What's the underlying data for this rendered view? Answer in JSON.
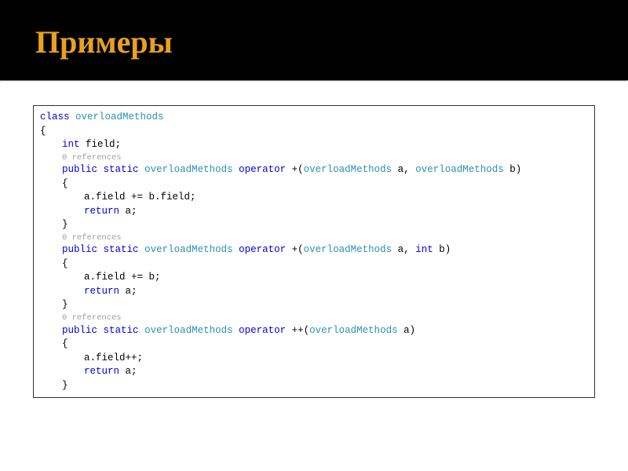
{
  "slide": {
    "title": "Примеры"
  },
  "code": {
    "ref_text": "0 references",
    "kw": {
      "class": "class",
      "int": "int",
      "public": "public",
      "static": "static",
      "operator": "operator",
      "return": "return"
    },
    "typ": {
      "overloadMethods": "overloadMethods"
    },
    "lines": {
      "l1_class": "class ",
      "l2_brace": "{",
      "l3_pre": "    ",
      "l3_int": "int",
      "l3_rest": " field;",
      "m1_sig_pre": "public static ",
      "m1_sig_mid1": " operator +(",
      "m1_sig_mid2": " a, ",
      "m1_sig_end": " b)",
      "m_brace_open": "{",
      "m1_body1": "a.field += b.field;",
      "m_return": "return",
      "m_return_rest": " a;",
      "m_brace_close": "}",
      "m2_sig_pre": "public static ",
      "m2_sig_mid1": " operator +(",
      "m2_sig_mid2": " a, ",
      "m2_sig_int": "int",
      "m2_sig_end": " b)",
      "m2_body1": "a.field += b;",
      "m3_sig_pre": "public static ",
      "m3_sig_mid1": " operator ++(",
      "m3_sig_end": " a)",
      "m3_body1": "a.field++;"
    }
  }
}
